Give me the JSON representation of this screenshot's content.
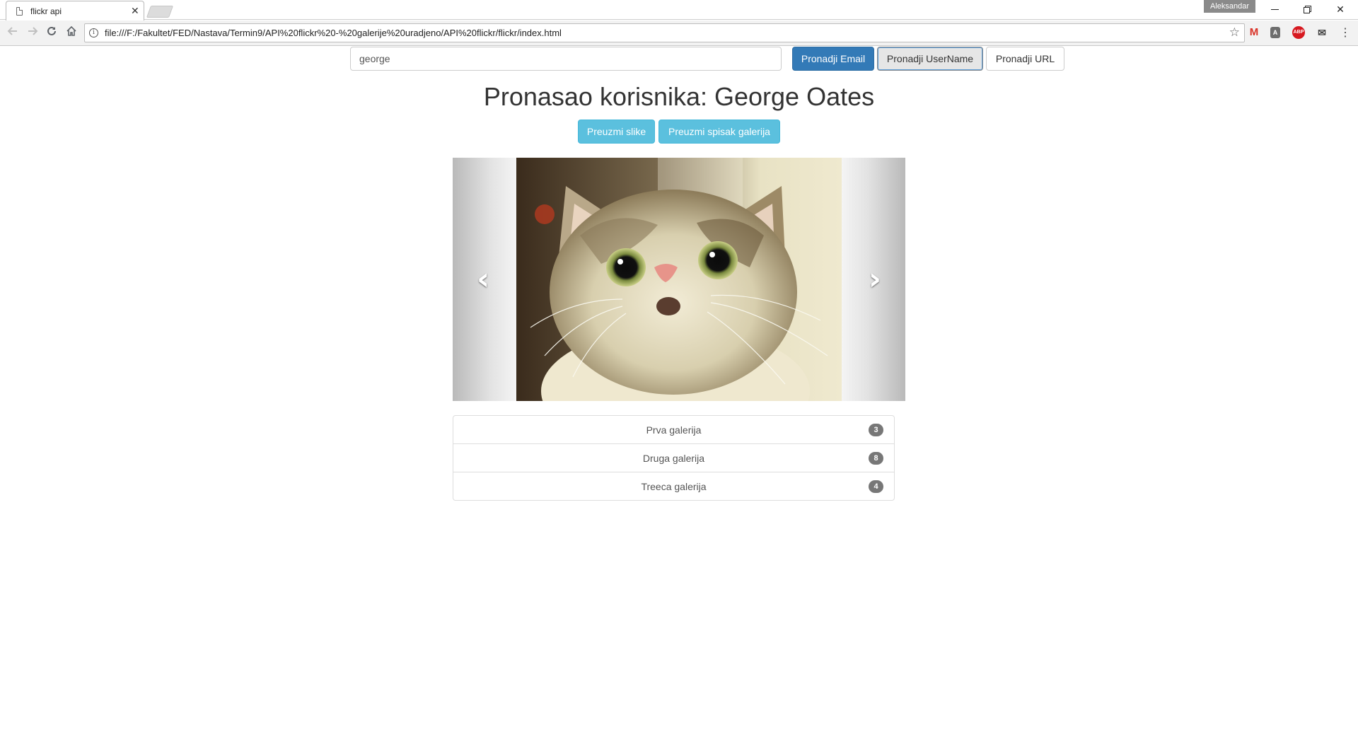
{
  "browser": {
    "tab_title": "flickr api",
    "tab_close": "✕",
    "profile": "Aleksandar",
    "url": "file:///F:/Fakultet/FED/Nastava/Termin9/API%20flickr%20-%20galerije%20uradjeno/API%20flickr/flickr/index.html",
    "icons": {
      "back": "arrow-left-icon",
      "forward": "arrow-right-icon",
      "reload": "reload-icon",
      "home": "home-icon",
      "info": "info-icon",
      "star": "star-icon",
      "menu": "menu-dots-icon"
    }
  },
  "search": {
    "value": "george",
    "buttons": {
      "email": "Pronadji Email",
      "username": "Pronadji UserName",
      "url": "Pronadji URL"
    }
  },
  "result": {
    "title": "Pronasao korisnika: George Oates",
    "actions": {
      "images": "Preuzmi slike",
      "galleries": "Preuzmi spisak galerija"
    }
  },
  "carousel": {
    "prev_icon": "chevron-left-icon",
    "next_icon": "chevron-right-icon",
    "image": "surprised-cat-photo"
  },
  "galleries": [
    {
      "name": "Prva galerija",
      "count": "3"
    },
    {
      "name": "Druga galerija",
      "count": "8"
    },
    {
      "name": "Treeca galerija",
      "count": "4"
    }
  ],
  "colors": {
    "primary": "#337ab7",
    "info": "#5bc0de",
    "badge": "#777777"
  }
}
